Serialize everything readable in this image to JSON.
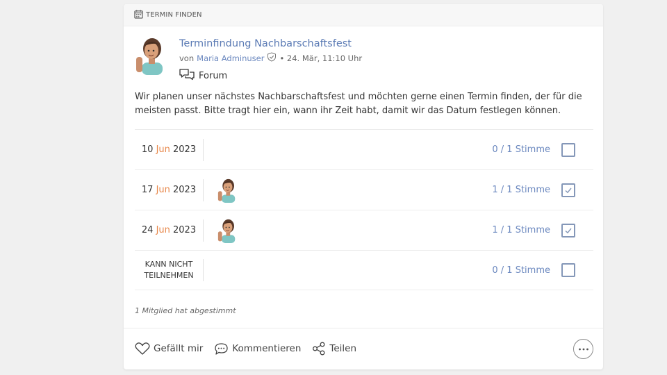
{
  "card": {
    "header_label": "TERMIN FINDEN"
  },
  "post": {
    "title": "Terminfindung Nachbarschaftsfest",
    "by_prefix": "von",
    "author": "Maria Adminuser",
    "meta_suffix": "• 24. Mär, 11:10 Uhr",
    "space": "Forum",
    "body": "Wir planen unser nächstes Nachbarschaftsfest und möchten gerne einen Termin finden, der für die meisten passt. Bitte tragt hier ein, wann ihr Zeit habt, damit wir das Datum festlegen können."
  },
  "poll": {
    "options": [
      {
        "day": "10",
        "month": "Jun",
        "year": "2023",
        "votes": "0 / 1 Stimme",
        "checked": false,
        "voters": 0
      },
      {
        "day": "17",
        "month": "Jun",
        "year": "2023",
        "votes": "1 / 1 Stimme",
        "checked": true,
        "voters": 1
      },
      {
        "day": "24",
        "month": "Jun",
        "year": "2023",
        "votes": "1 / 1 Stimme",
        "checked": true,
        "voters": 1
      },
      {
        "label_line1": "KANN NICHT",
        "label_line2": "TEILNEHMEN",
        "votes": "0 / 1 Stimme",
        "checked": false,
        "voters": 0
      }
    ],
    "summary": "1 Mitglied hat abgestimmt"
  },
  "actions": {
    "like": "Gefällt mir",
    "comment": "Kommentieren",
    "share": "Teilen"
  },
  "colors": {
    "link": "#5a7ab4",
    "month": "#e8894d",
    "checkbox": "#8497b8"
  },
  "icons": {
    "header": "calendar-icon",
    "verified": "shield-check-icon",
    "space": "chat-bubbles-icon",
    "like": "heart-icon",
    "comment": "speech-bubble-icon",
    "share": "share-icon",
    "more": "ellipsis-icon"
  }
}
